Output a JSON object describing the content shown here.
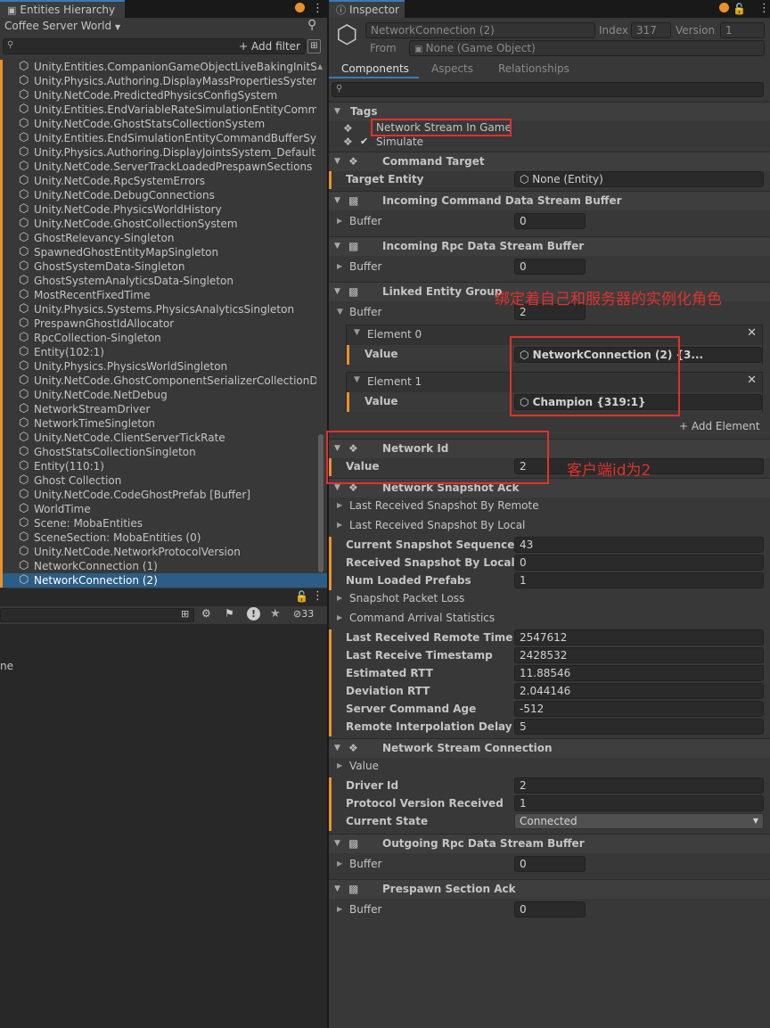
{
  "hierarchy": {
    "tab_title": "Entities Hierarchy",
    "world_selector": "Coffee Server World",
    "add_filter": "+ Add filter",
    "items": [
      {
        "label": "Unity.Entities.CompanionGameObjectLiveBakingInitSystem",
        "selected": false
      },
      {
        "label": "Unity.Physics.Authoring.DisplayMassPropertiesSystem",
        "selected": false
      },
      {
        "label": "Unity.NetCode.PredictedPhysicsConfigSystem",
        "selected": false
      },
      {
        "label": "Unity.Entities.EndVariableRateSimulationEntityCommandBufferSystem",
        "selected": false
      },
      {
        "label": "Unity.NetCode.GhostStatsCollectionSystem",
        "selected": false
      },
      {
        "label": "Unity.Entities.EndSimulationEntityCommandBufferSystem",
        "selected": false
      },
      {
        "label": "Unity.Physics.Authoring.DisplayJointsSystem_Default",
        "selected": false
      },
      {
        "label": "Unity.NetCode.ServerTrackLoadedPrespawnSections",
        "selected": false
      },
      {
        "label": "Unity.NetCode.RpcSystemErrors",
        "selected": false
      },
      {
        "label": "Unity.NetCode.DebugConnections",
        "selected": false
      },
      {
        "label": "Unity.NetCode.PhysicsWorldHistory",
        "selected": false
      },
      {
        "label": "Unity.NetCode.GhostCollectionSystem",
        "selected": false
      },
      {
        "label": "GhostRelevancy-Singleton",
        "selected": false
      },
      {
        "label": "SpawnedGhostEntityMapSingleton",
        "selected": false
      },
      {
        "label": "GhostSystemData-Singleton",
        "selected": false
      },
      {
        "label": "GhostSystemAnalyticsData-Singleton",
        "selected": false
      },
      {
        "label": "MostRecentFixedTime",
        "selected": false
      },
      {
        "label": "Unity.Physics.Systems.PhysicsAnalyticsSingleton",
        "selected": false
      },
      {
        "label": "PrespawnGhostIdAllocator",
        "selected": false
      },
      {
        "label": "RpcCollection-Singleton",
        "selected": false
      },
      {
        "label": "Entity(102:1)",
        "selected": false
      },
      {
        "label": "Unity.Physics.PhysicsWorldSingleton",
        "selected": false
      },
      {
        "label": "Unity.NetCode.GhostComponentSerializerCollectionData",
        "selected": false
      },
      {
        "label": "Unity.NetCode.NetDebug",
        "selected": false
      },
      {
        "label": "NetworkStreamDriver",
        "selected": false
      },
      {
        "label": "NetworkTimeSingleton",
        "selected": false
      },
      {
        "label": "Unity.NetCode.ClientServerTickRate",
        "selected": false
      },
      {
        "label": "GhostStatsCollectionSingleton",
        "selected": false
      },
      {
        "label": "Entity(110:1)",
        "selected": false
      },
      {
        "label": "Ghost Collection",
        "selected": false
      },
      {
        "label": "Unity.NetCode.CodeGhostPrefab [Buffer]",
        "selected": false
      },
      {
        "label": "WorldTime",
        "selected": false
      },
      {
        "label": "Scene: MobaEntities",
        "selected": false
      },
      {
        "label": "SceneSection: MobaEntities (0)",
        "selected": false
      },
      {
        "label": "Unity.NetCode.NetworkProtocolVersion",
        "selected": false
      },
      {
        "label": "NetworkConnection (1)",
        "selected": false
      },
      {
        "label": "NetworkConnection (2)",
        "selected": true
      }
    ]
  },
  "lower_panel": {
    "hidden_count": "33",
    "partial_text": "ne"
  },
  "inspector": {
    "tab_title": "Inspector",
    "entity_name": "NetworkConnection (2)",
    "index_label": "Index",
    "index_value": "317",
    "version_label": "Version",
    "version_value": "1",
    "from_label": "From",
    "from_value": "None (Game Object)",
    "tabs": {
      "components": "Components",
      "aspects": "Aspects",
      "relationships": "Relationships"
    },
    "tags_title": "Tags",
    "tag_network_stream": "Network Stream In Game",
    "tag_simulate": "Simulate",
    "command_target": {
      "title": "Command Target",
      "field_label": "Target Entity",
      "value": "None (Entity)"
    },
    "incoming_cmd": {
      "title": "Incoming Command Data Stream Buffer",
      "buffer_label": "Buffer",
      "value": "0"
    },
    "incoming_rpc": {
      "title": "Incoming Rpc Data Stream Buffer",
      "buffer_label": "Buffer",
      "value": "0"
    },
    "linked_group": {
      "title": "Linked Entity Group",
      "buffer_label": "Buffer",
      "value": "2",
      "elements": [
        {
          "title": "Element 0",
          "value_label": "Value",
          "value": "NetworkConnection (2) {3..."
        },
        {
          "title": "Element 1",
          "value_label": "Value",
          "value": "Champion {319:1}"
        }
      ],
      "add_element": "+ Add Element"
    },
    "network_id": {
      "title": "Network Id",
      "value_label": "Value",
      "value": "2"
    },
    "snapshot_ack": {
      "title": "Network Snapshot Ack",
      "fold_remote": "Last Received Snapshot By Remote",
      "fold_local": "Last Received Snapshot By Local",
      "fields": [
        {
          "label": "Current Snapshot Sequence Id",
          "value": "43"
        },
        {
          "label": "Received Snapshot By Local ...",
          "value": "0"
        },
        {
          "label": "Num Loaded Prefabs",
          "value": "1"
        }
      ],
      "fold_packet_loss": "Snapshot Packet Loss",
      "fold_arrival": "Command Arrival Statistics",
      "fields2": [
        {
          "label": "Last Received Remote Time",
          "value": "2547612"
        },
        {
          "label": "Last Receive Timestamp",
          "value": "2428532"
        },
        {
          "label": "Estimated RTT",
          "value": "11.88546"
        },
        {
          "label": "Deviation RTT",
          "value": "2.044146"
        },
        {
          "label": "Server Command Age",
          "value": "-512"
        },
        {
          "label": "Remote Interpolation Delay",
          "value": "5"
        }
      ]
    },
    "stream_conn": {
      "title": "Network Stream Connection",
      "fold_value": "Value",
      "driver_label": "Driver Id",
      "driver_value": "2",
      "protocol_label": "Protocol Version Received",
      "protocol_value": "1",
      "state_label": "Current State",
      "state_value": "Connected"
    },
    "outgoing_rpc": {
      "title": "Outgoing Rpc Data Stream Buffer",
      "buffer_label": "Buffer",
      "value": "0"
    },
    "prespawn_ack": {
      "title": "Prespawn Section Ack",
      "buffer_label": "Buffer",
      "value": "0"
    }
  },
  "annotations": {
    "linked_note": "绑定着自己和服务器的实例化角色",
    "id_note": "客户端id为2"
  },
  "colors": {
    "accent": "#e9922a",
    "selection": "#2c5d87",
    "annotation": "#e0312c",
    "tab_highlight": "#3a79bb"
  }
}
